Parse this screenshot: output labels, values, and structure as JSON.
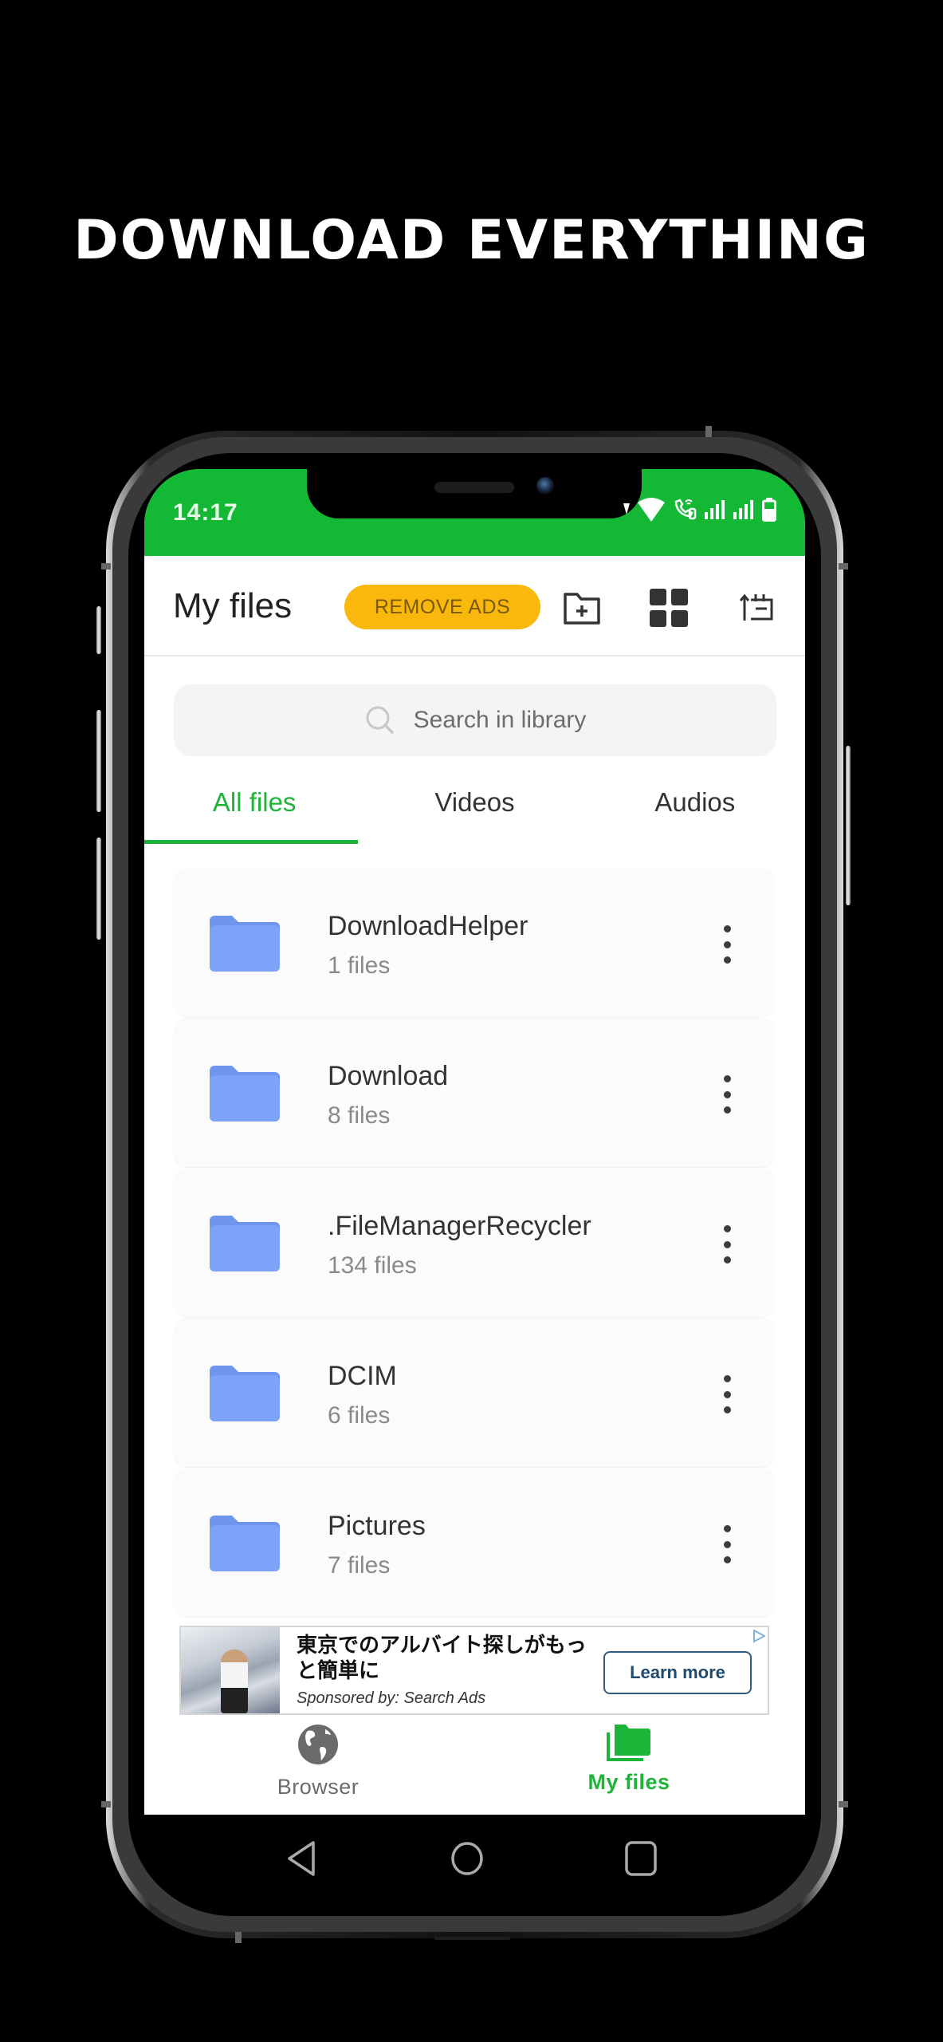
{
  "promo": {
    "headline": "DOWNLOAD EVERYTHING"
  },
  "status_bar": {
    "time": "14:17",
    "icons": [
      "data-arrow-icon",
      "wifi-icon",
      "wifi-call-icon",
      "signal-icon",
      "signal-icon",
      "battery-icon"
    ]
  },
  "header": {
    "title": "My files",
    "remove_ads_label": "REMOVE ADS",
    "actions": [
      "new-folder-icon",
      "grid-view-icon",
      "sort-icon"
    ]
  },
  "search": {
    "placeholder": "Search in library",
    "value": ""
  },
  "tabs": [
    {
      "label": "All files",
      "active": true
    },
    {
      "label": "Videos",
      "active": false
    },
    {
      "label": "Audios",
      "active": false
    }
  ],
  "folders": [
    {
      "name": "DownloadHelper",
      "count": "1 files"
    },
    {
      "name": "Download",
      "count": "8 files"
    },
    {
      "name": ".FileManagerRecycler",
      "count": "134 files"
    },
    {
      "name": "DCIM",
      "count": "6 files"
    },
    {
      "name": "Pictures",
      "count": "7 files"
    }
  ],
  "ad": {
    "title": "東京でのアルバイト探しがもっと簡単に",
    "sponsor": "Sponsored by: Search Ads",
    "cta": "Learn more"
  },
  "bottom_nav": [
    {
      "label": "Browser",
      "icon": "globe-icon",
      "active": false
    },
    {
      "label": "My files",
      "icon": "folders-icon",
      "active": true
    }
  ],
  "colors": {
    "brand_green": "#13b834",
    "accent_yellow": "#fbb80c",
    "folder_blue": "#7ba4f7",
    "ad_cta": "#1f4a6e"
  }
}
